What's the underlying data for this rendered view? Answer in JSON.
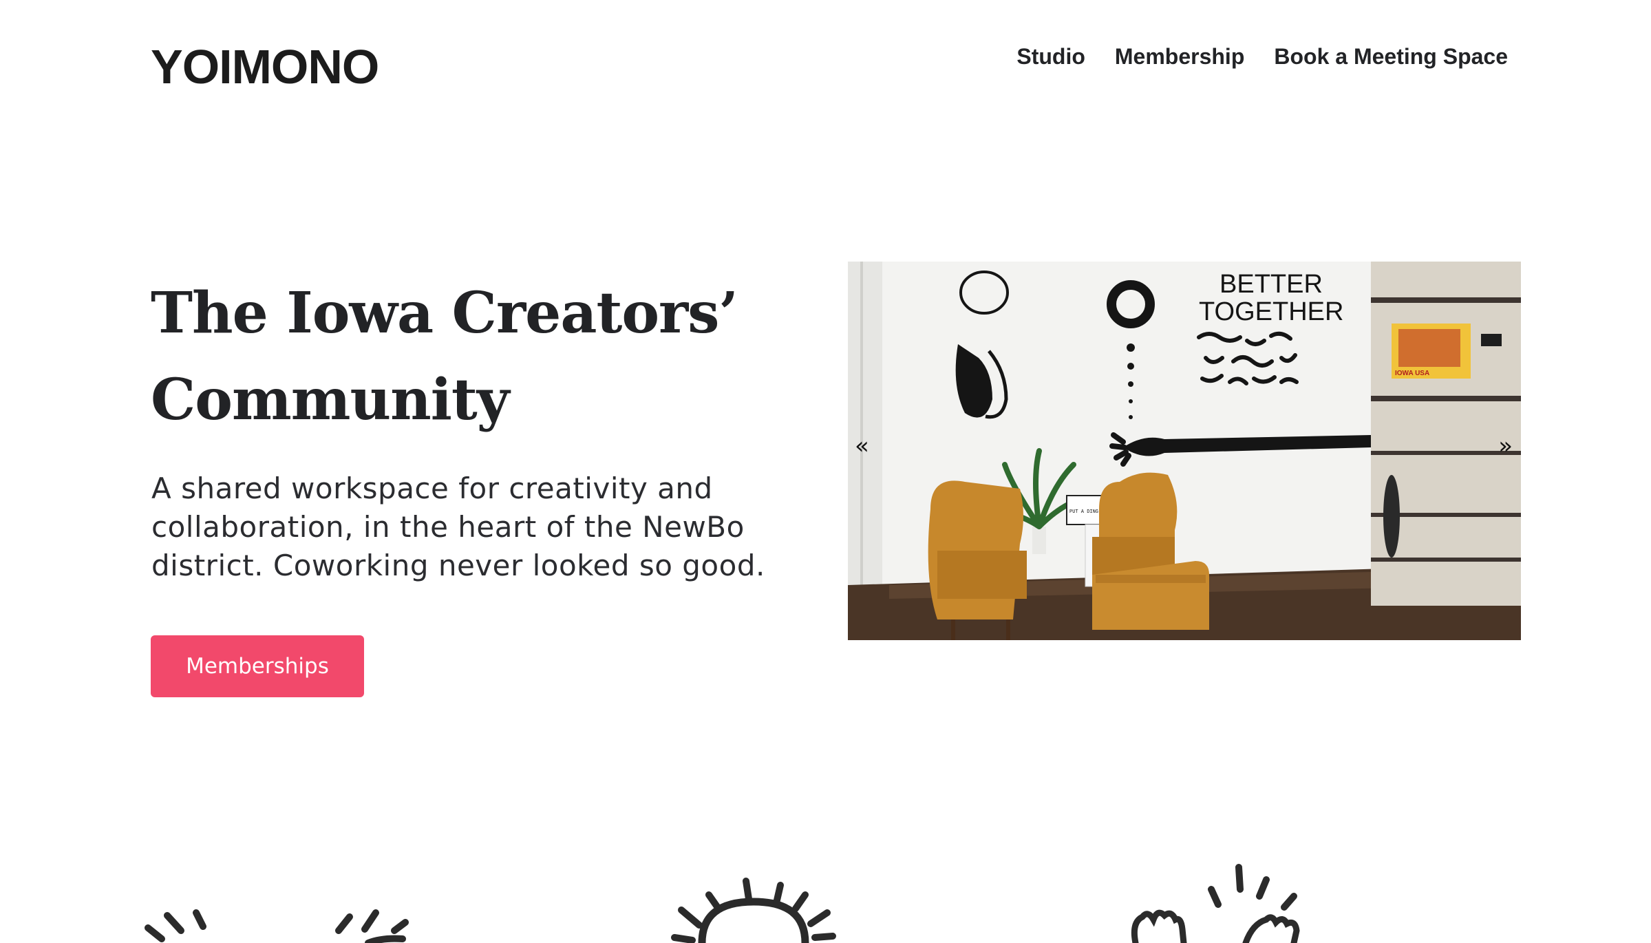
{
  "header": {
    "logo_text": "YOIMONO",
    "nav": [
      {
        "label": "Studio"
      },
      {
        "label": "Membership"
      },
      {
        "label": "Book a Meeting Space"
      }
    ]
  },
  "hero": {
    "title": "The Iowa Creators’ Community",
    "subtitle": "A shared workspace for creativity and collaboration, in the heart of the NewBo district. Coworking never looked so good.",
    "cta_label": "Memberships",
    "cta_color": "#f2496b"
  },
  "carousel": {
    "prev_label": "«",
    "next_label": "»",
    "wall_text_line1": "BETTER",
    "wall_text_line2": "TOGETHER",
    "poster_text": "IOWA USA",
    "lightbox_text": "PUT A DING IN THE UNIVERSE"
  },
  "icons": [
    "logo-icon",
    "clapping-hands-icon",
    "sun-icon",
    "raised-hands-icon"
  ]
}
